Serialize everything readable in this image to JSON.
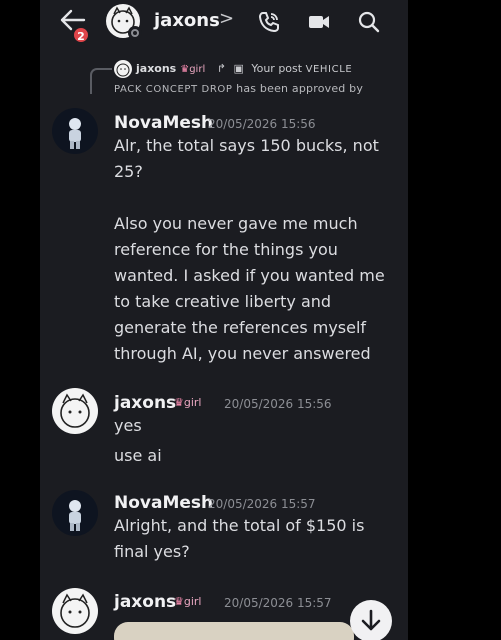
{
  "header": {
    "unread_badge": "2",
    "channel_name": "jaxons",
    "chevron": ">",
    "icons": [
      "back-arrow-icon",
      "phone-call-icon",
      "video-camera-icon",
      "search-icon"
    ]
  },
  "reply": {
    "author": "jaxons",
    "tag": "girl",
    "prefix": "Your post ",
    "post_title_a": "VEHICLE",
    "post_title_b": "PACK CONCEPT DROP",
    "suffix": " has been approved by"
  },
  "messages": [
    {
      "author": "NovaMesh",
      "timestamp": "20/05/2026 15:56",
      "lines": [
        "Alr, the total says 150 bucks, not",
        "25?",
        "",
        "Also you never gave me much",
        "reference for the things you",
        "wanted. I asked if you wanted me",
        "to take creative liberty and",
        "generate the references myself",
        "through AI, you never answered"
      ]
    },
    {
      "author": "jaxons",
      "tag": "girl",
      "timestamp": "20/05/2026 15:56",
      "lines": [
        "yes",
        "",
        "use ai"
      ]
    },
    {
      "author": "NovaMesh",
      "timestamp": "20/05/2026 15:57",
      "lines": [
        "Alright, and the total of $150 is",
        "final yes?"
      ]
    },
    {
      "author": "jaxons",
      "tag": "girl",
      "timestamp": "20/05/2026 15:57",
      "lines": []
    }
  ]
}
